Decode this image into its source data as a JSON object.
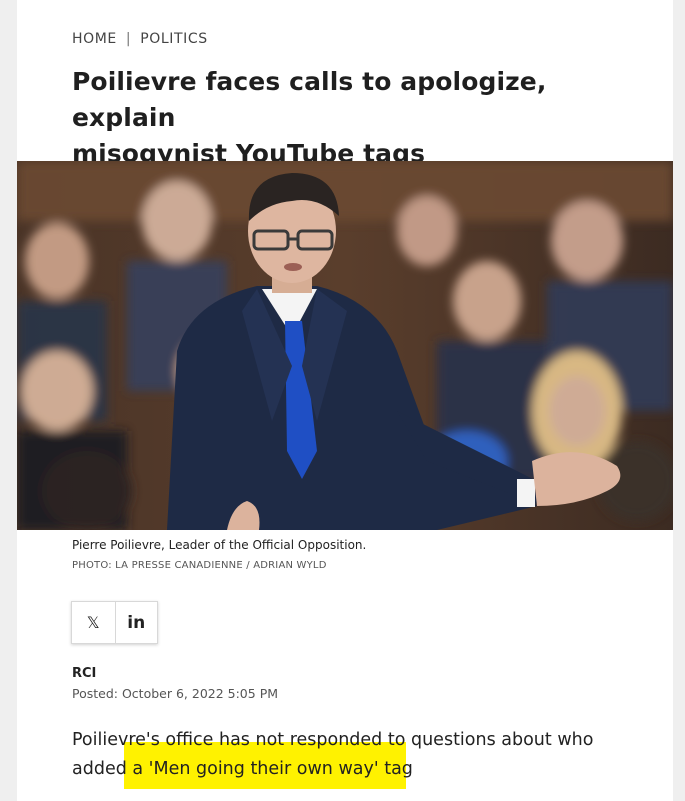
{
  "breadcrumb": {
    "home": "HOME",
    "separator": "|",
    "section": "POLITICS"
  },
  "headline": {
    "line1": "Poilievre faces calls to apologize, explain",
    "line2": "misogynist YouTube tags"
  },
  "photo": {
    "caption": "Pierre Poilievre, Leader of the Official Opposition.",
    "credit": "PHOTO: LA PRESSE CANADIENNE / ADRIAN WYLD"
  },
  "share": {
    "x_glyph": "𝕏",
    "linkedin_glyph": "in"
  },
  "byline": {
    "author": "RCI",
    "posted": "Posted: October 6, 2022 5:05 PM"
  },
  "article": {
    "line1": "Poilievre's office has not responded to questions about who",
    "line2_plain": "added ",
    "line2_highlighted": "a 'Men going their own way' tag"
  },
  "colors": {
    "highlight": "#fff200",
    "suit": "#1e2a45",
    "tie": "#1f4fc4",
    "background": "#efefef"
  }
}
